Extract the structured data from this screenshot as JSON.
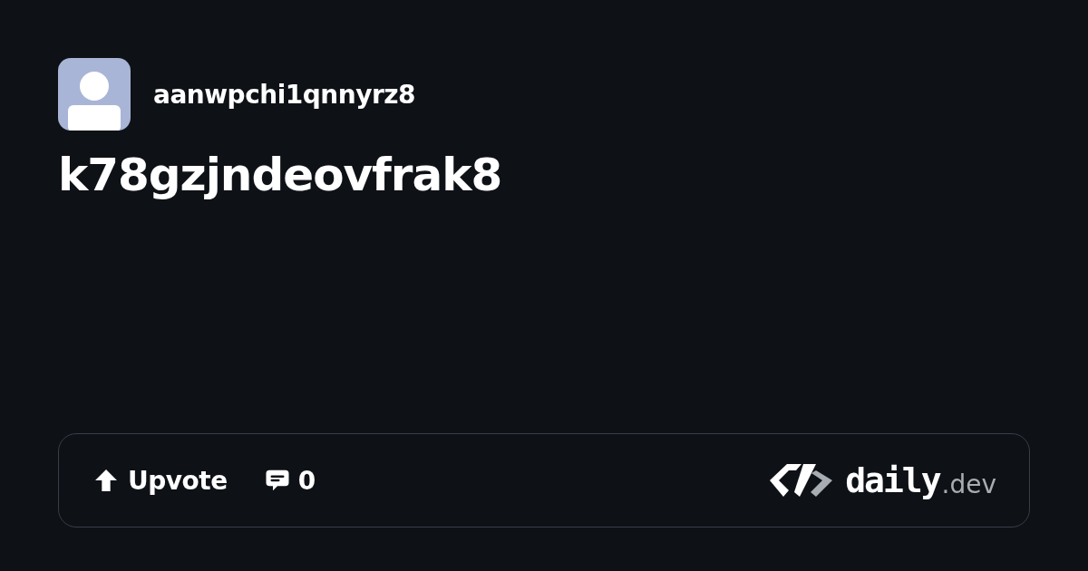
{
  "author": {
    "name": "aanwpchi1qnnyrz8"
  },
  "post": {
    "title": "k78gzjndeovfrak8"
  },
  "footer": {
    "upvote": {
      "label": "Upvote"
    },
    "comments": {
      "count": "0"
    },
    "brand": {
      "name": "daily",
      "suffix": ".dev"
    }
  }
}
